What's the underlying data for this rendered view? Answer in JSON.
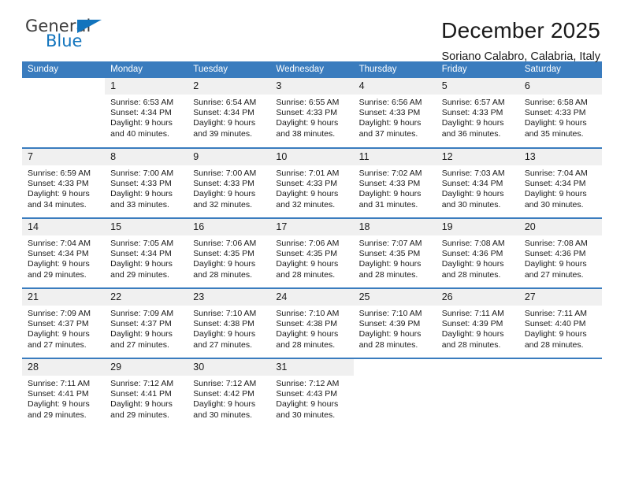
{
  "brand": {
    "name_top": "General",
    "name_bottom": "Blue",
    "accent_color": "#1274bd",
    "triangle_icon": "triangle-icon"
  },
  "header": {
    "title": "December 2025",
    "subtitle": "Soriano Calabro, Calabria, Italy"
  },
  "colors": {
    "header_row_bg": "#3a7cbe",
    "daynum_bg": "#f0f0f0",
    "row_divider": "#3a7cbe",
    "text": "#1a1a1a"
  },
  "weekdays": [
    "Sunday",
    "Monday",
    "Tuesday",
    "Wednesday",
    "Thursday",
    "Friday",
    "Saturday"
  ],
  "weeks": [
    [
      {
        "day": "",
        "sunrise": "",
        "sunset": "",
        "daylight_line1": "",
        "daylight_line2": "",
        "empty": true
      },
      {
        "day": "1",
        "sunrise": "Sunrise: 6:53 AM",
        "sunset": "Sunset: 4:34 PM",
        "daylight_line1": "Daylight: 9 hours",
        "daylight_line2": "and 40 minutes."
      },
      {
        "day": "2",
        "sunrise": "Sunrise: 6:54 AM",
        "sunset": "Sunset: 4:34 PM",
        "daylight_line1": "Daylight: 9 hours",
        "daylight_line2": "and 39 minutes."
      },
      {
        "day": "3",
        "sunrise": "Sunrise: 6:55 AM",
        "sunset": "Sunset: 4:33 PM",
        "daylight_line1": "Daylight: 9 hours",
        "daylight_line2": "and 38 minutes."
      },
      {
        "day": "4",
        "sunrise": "Sunrise: 6:56 AM",
        "sunset": "Sunset: 4:33 PM",
        "daylight_line1": "Daylight: 9 hours",
        "daylight_line2": "and 37 minutes."
      },
      {
        "day": "5",
        "sunrise": "Sunrise: 6:57 AM",
        "sunset": "Sunset: 4:33 PM",
        "daylight_line1": "Daylight: 9 hours",
        "daylight_line2": "and 36 minutes."
      },
      {
        "day": "6",
        "sunrise": "Sunrise: 6:58 AM",
        "sunset": "Sunset: 4:33 PM",
        "daylight_line1": "Daylight: 9 hours",
        "daylight_line2": "and 35 minutes."
      }
    ],
    [
      {
        "day": "7",
        "sunrise": "Sunrise: 6:59 AM",
        "sunset": "Sunset: 4:33 PM",
        "daylight_line1": "Daylight: 9 hours",
        "daylight_line2": "and 34 minutes."
      },
      {
        "day": "8",
        "sunrise": "Sunrise: 7:00 AM",
        "sunset": "Sunset: 4:33 PM",
        "daylight_line1": "Daylight: 9 hours",
        "daylight_line2": "and 33 minutes."
      },
      {
        "day": "9",
        "sunrise": "Sunrise: 7:00 AM",
        "sunset": "Sunset: 4:33 PM",
        "daylight_line1": "Daylight: 9 hours",
        "daylight_line2": "and 32 minutes."
      },
      {
        "day": "10",
        "sunrise": "Sunrise: 7:01 AM",
        "sunset": "Sunset: 4:33 PM",
        "daylight_line1": "Daylight: 9 hours",
        "daylight_line2": "and 32 minutes."
      },
      {
        "day": "11",
        "sunrise": "Sunrise: 7:02 AM",
        "sunset": "Sunset: 4:33 PM",
        "daylight_line1": "Daylight: 9 hours",
        "daylight_line2": "and 31 minutes."
      },
      {
        "day": "12",
        "sunrise": "Sunrise: 7:03 AM",
        "sunset": "Sunset: 4:34 PM",
        "daylight_line1": "Daylight: 9 hours",
        "daylight_line2": "and 30 minutes."
      },
      {
        "day": "13",
        "sunrise": "Sunrise: 7:04 AM",
        "sunset": "Sunset: 4:34 PM",
        "daylight_line1": "Daylight: 9 hours",
        "daylight_line2": "and 30 minutes."
      }
    ],
    [
      {
        "day": "14",
        "sunrise": "Sunrise: 7:04 AM",
        "sunset": "Sunset: 4:34 PM",
        "daylight_line1": "Daylight: 9 hours",
        "daylight_line2": "and 29 minutes."
      },
      {
        "day": "15",
        "sunrise": "Sunrise: 7:05 AM",
        "sunset": "Sunset: 4:34 PM",
        "daylight_line1": "Daylight: 9 hours",
        "daylight_line2": "and 29 minutes."
      },
      {
        "day": "16",
        "sunrise": "Sunrise: 7:06 AM",
        "sunset": "Sunset: 4:35 PM",
        "daylight_line1": "Daylight: 9 hours",
        "daylight_line2": "and 28 minutes."
      },
      {
        "day": "17",
        "sunrise": "Sunrise: 7:06 AM",
        "sunset": "Sunset: 4:35 PM",
        "daylight_line1": "Daylight: 9 hours",
        "daylight_line2": "and 28 minutes."
      },
      {
        "day": "18",
        "sunrise": "Sunrise: 7:07 AM",
        "sunset": "Sunset: 4:35 PM",
        "daylight_line1": "Daylight: 9 hours",
        "daylight_line2": "and 28 minutes."
      },
      {
        "day": "19",
        "sunrise": "Sunrise: 7:08 AM",
        "sunset": "Sunset: 4:36 PM",
        "daylight_line1": "Daylight: 9 hours",
        "daylight_line2": "and 28 minutes."
      },
      {
        "day": "20",
        "sunrise": "Sunrise: 7:08 AM",
        "sunset": "Sunset: 4:36 PM",
        "daylight_line1": "Daylight: 9 hours",
        "daylight_line2": "and 27 minutes."
      }
    ],
    [
      {
        "day": "21",
        "sunrise": "Sunrise: 7:09 AM",
        "sunset": "Sunset: 4:37 PM",
        "daylight_line1": "Daylight: 9 hours",
        "daylight_line2": "and 27 minutes."
      },
      {
        "day": "22",
        "sunrise": "Sunrise: 7:09 AM",
        "sunset": "Sunset: 4:37 PM",
        "daylight_line1": "Daylight: 9 hours",
        "daylight_line2": "and 27 minutes."
      },
      {
        "day": "23",
        "sunrise": "Sunrise: 7:10 AM",
        "sunset": "Sunset: 4:38 PM",
        "daylight_line1": "Daylight: 9 hours",
        "daylight_line2": "and 27 minutes."
      },
      {
        "day": "24",
        "sunrise": "Sunrise: 7:10 AM",
        "sunset": "Sunset: 4:38 PM",
        "daylight_line1": "Daylight: 9 hours",
        "daylight_line2": "and 28 minutes."
      },
      {
        "day": "25",
        "sunrise": "Sunrise: 7:10 AM",
        "sunset": "Sunset: 4:39 PM",
        "daylight_line1": "Daylight: 9 hours",
        "daylight_line2": "and 28 minutes."
      },
      {
        "day": "26",
        "sunrise": "Sunrise: 7:11 AM",
        "sunset": "Sunset: 4:39 PM",
        "daylight_line1": "Daylight: 9 hours",
        "daylight_line2": "and 28 minutes."
      },
      {
        "day": "27",
        "sunrise": "Sunrise: 7:11 AM",
        "sunset": "Sunset: 4:40 PM",
        "daylight_line1": "Daylight: 9 hours",
        "daylight_line2": "and 28 minutes."
      }
    ],
    [
      {
        "day": "28",
        "sunrise": "Sunrise: 7:11 AM",
        "sunset": "Sunset: 4:41 PM",
        "daylight_line1": "Daylight: 9 hours",
        "daylight_line2": "and 29 minutes."
      },
      {
        "day": "29",
        "sunrise": "Sunrise: 7:12 AM",
        "sunset": "Sunset: 4:41 PM",
        "daylight_line1": "Daylight: 9 hours",
        "daylight_line2": "and 29 minutes."
      },
      {
        "day": "30",
        "sunrise": "Sunrise: 7:12 AM",
        "sunset": "Sunset: 4:42 PM",
        "daylight_line1": "Daylight: 9 hours",
        "daylight_line2": "and 30 minutes."
      },
      {
        "day": "31",
        "sunrise": "Sunrise: 7:12 AM",
        "sunset": "Sunset: 4:43 PM",
        "daylight_line1": "Daylight: 9 hours",
        "daylight_line2": "and 30 minutes."
      },
      {
        "day": "",
        "sunrise": "",
        "sunset": "",
        "daylight_line1": "",
        "daylight_line2": "",
        "empty": true
      },
      {
        "day": "",
        "sunrise": "",
        "sunset": "",
        "daylight_line1": "",
        "daylight_line2": "",
        "empty": true
      },
      {
        "day": "",
        "sunrise": "",
        "sunset": "",
        "daylight_line1": "",
        "daylight_line2": "",
        "empty": true
      }
    ]
  ]
}
